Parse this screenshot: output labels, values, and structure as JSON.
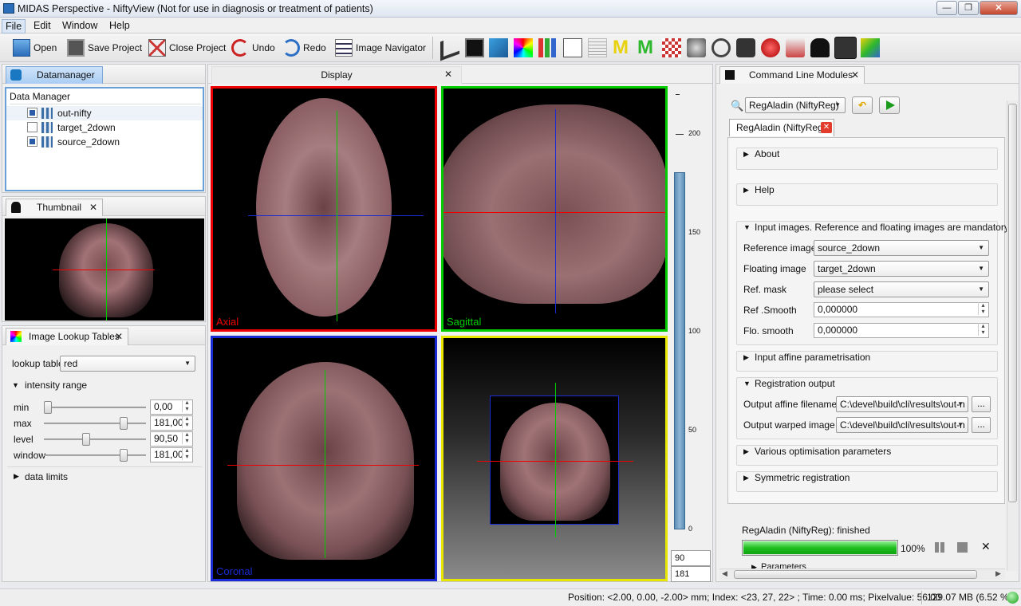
{
  "window": {
    "title": "MIDAS Perspective - NiftyView (Not for use in diagnosis or treatment of patients)",
    "min": "—",
    "max": "❐",
    "close": "✕"
  },
  "menu": [
    "File",
    "Edit",
    "Window",
    "Help"
  ],
  "toolbar": {
    "open": "Open",
    "save_project": "Save Project",
    "close_project": "Close Project",
    "undo": "Undo",
    "redo": "Redo",
    "image_navigator": "Image Navigator"
  },
  "datamanager": {
    "tab": "Datamanager",
    "header": "Data Manager",
    "items": [
      {
        "label": "out-nifty",
        "checked": true
      },
      {
        "label": "target_2down",
        "checked": false
      },
      {
        "label": "source_2down",
        "checked": true
      }
    ]
  },
  "thumbnail": {
    "tab": "Thumbnail"
  },
  "lookup": {
    "tab": "Image Lookup Tables",
    "lookup_label": "lookup table",
    "lookup_value": "red",
    "section": "intensity range",
    "rows": [
      {
        "label": "min",
        "value": "0,00",
        "pos": 0.0
      },
      {
        "label": "max",
        "value": "181,00",
        "pos": 0.78
      },
      {
        "label": "level",
        "value": "90,50",
        "pos": 0.4
      },
      {
        "label": "window",
        "value": "181,00",
        "pos": 0.78
      }
    ],
    "data_limits": "data limits"
  },
  "display": {
    "tab": "Display",
    "axial": "Axial",
    "sagittal": "Sagittal",
    "coronal": "Coronal",
    "ruler_ticks": [
      "200",
      "150",
      "100",
      "50",
      "0"
    ],
    "value1": "90",
    "value2": "181"
  },
  "cli": {
    "tab": "Command Line Modules",
    "module": "RegAladin (NiftyReg)",
    "subtab": "RegAladin (NiftyReg)",
    "about": "About",
    "help": "Help",
    "input_images": "Input images. Reference and floating images are mandatory",
    "reference_label": "Reference image",
    "reference_value": "source_2down",
    "floating_label": "Floating image",
    "floating_value": "target_2down",
    "mask_label": "Ref. mask",
    "mask_value": "please select",
    "refsmooth_label": "Ref .Smooth",
    "refsmooth_value": "0,000000",
    "flosmooth_label": "Flo. smooth",
    "flosmooth_value": "0,000000",
    "affine_param": "Input affine parametrisation",
    "reg_output": "Registration output",
    "out_affine_label": "Output affine filename",
    "out_affine_value": "C:\\devel\\build\\cli\\results\\out-n",
    "out_warped_label": "Output warped image",
    "out_warped_value": "C:\\devel\\build\\cli\\results\\out-n",
    "optim": "Various optimisation parameters",
    "symmetric": "Symmetric registration",
    "browse": "...",
    "status": "RegAladin (NiftyReg): finished",
    "progress": 1.0,
    "progress_text": "100%",
    "parameters": "Parameters"
  },
  "statusbar": {
    "position": "Position: <2.00, 0.00, -2.00> mm; Index: <23, 27, 22> ; Time: 0.00 ms; Pixelvalue: 56.00",
    "memory": "129.07 MB (6.52 %)"
  }
}
